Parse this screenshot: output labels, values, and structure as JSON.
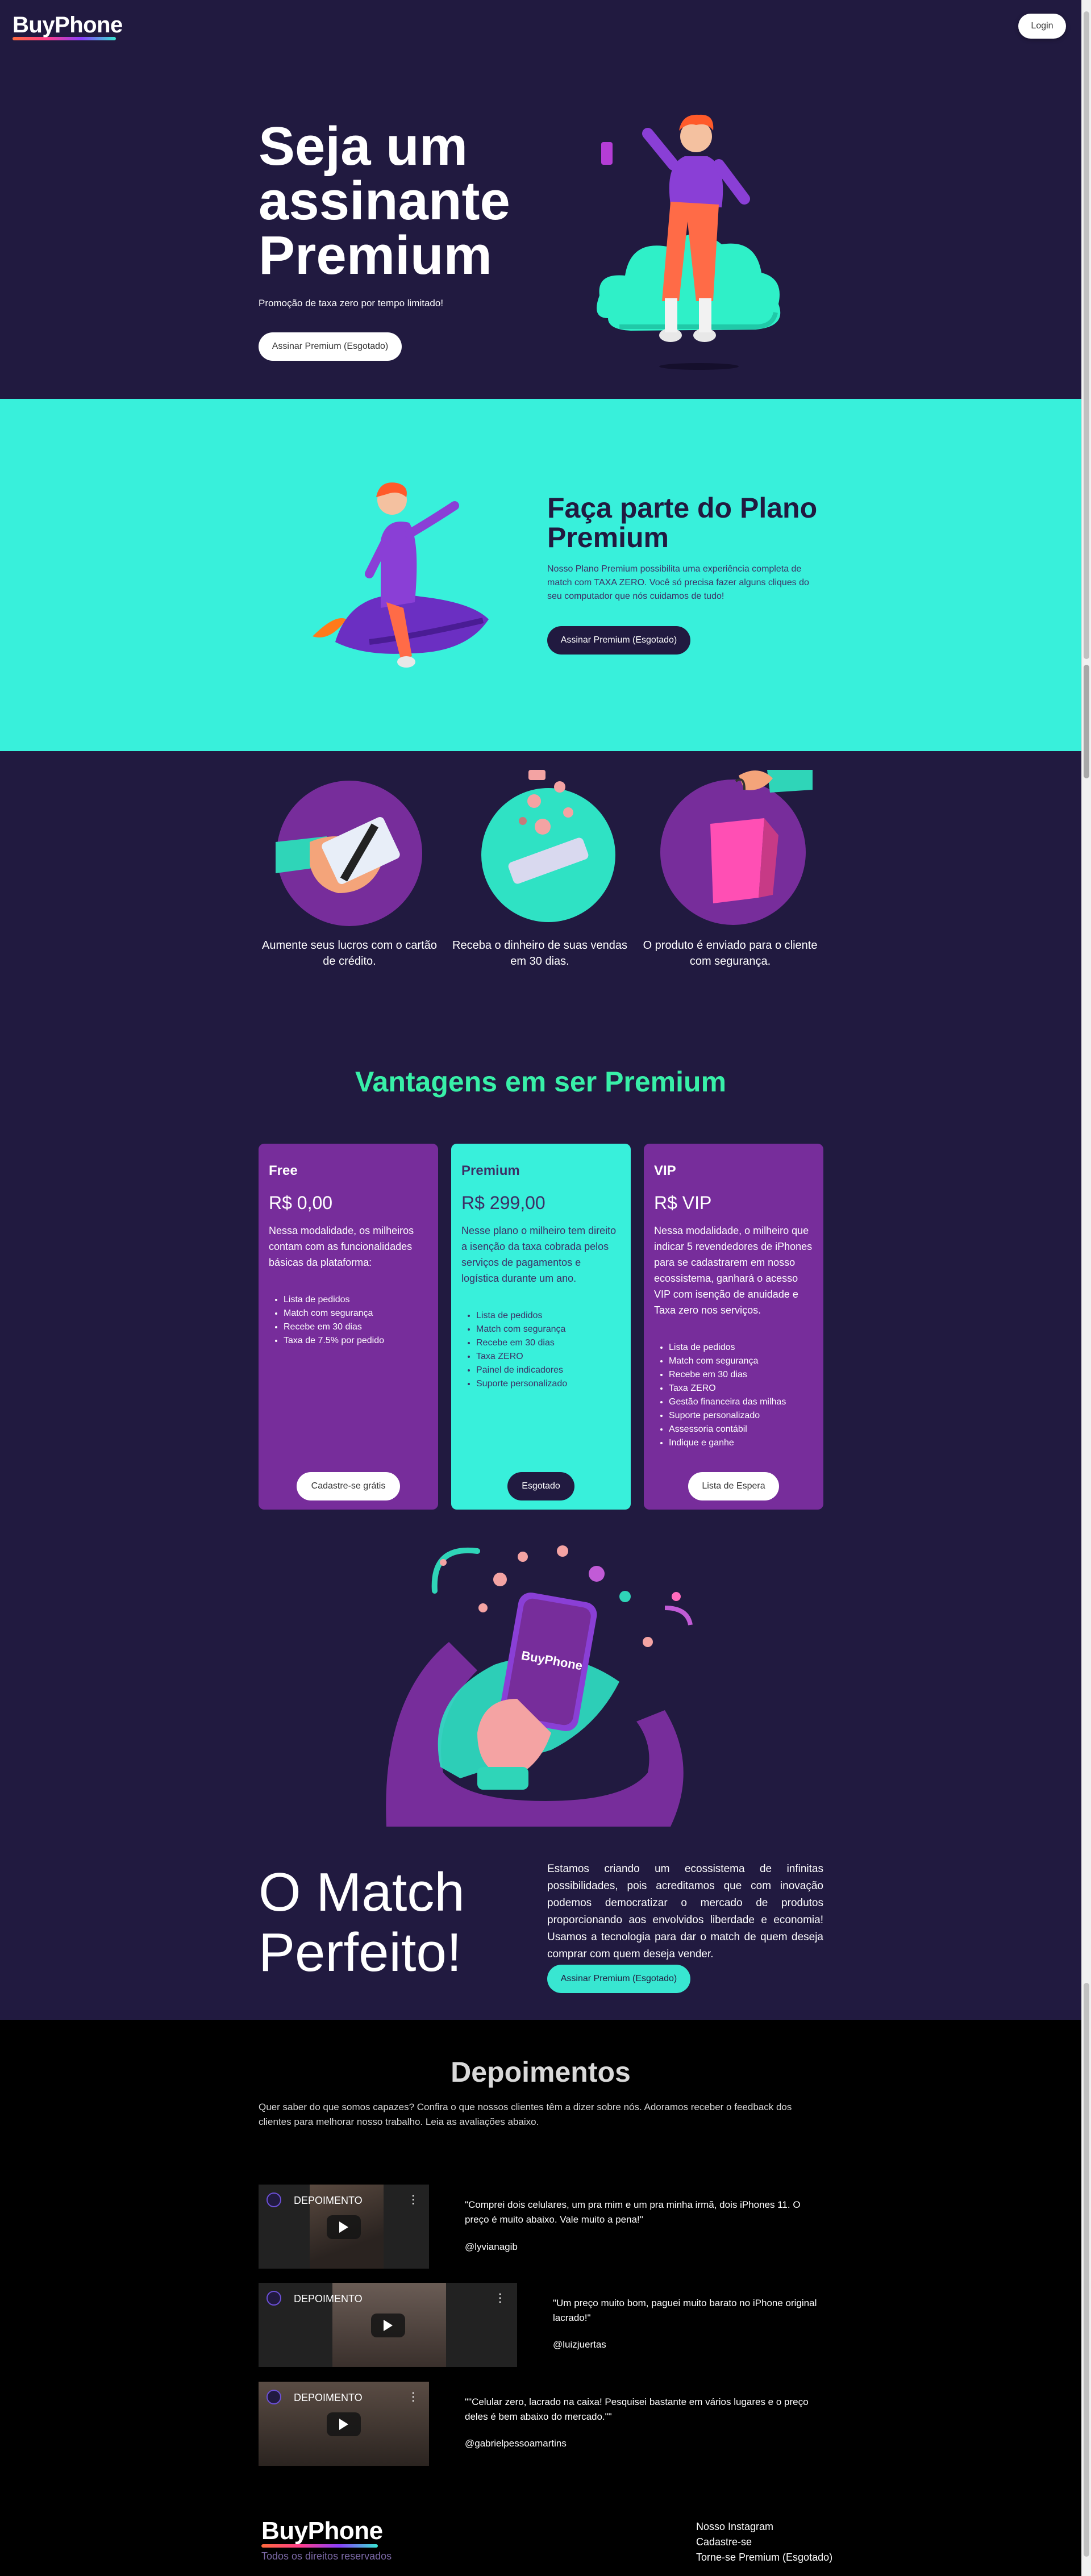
{
  "header": {
    "logo": "BuyPhone",
    "login": "Login"
  },
  "hero": {
    "title_lines": [
      "Seja um",
      "assinante",
      "Premium"
    ],
    "subtitle": "Promoção de taxa zero por tempo limitado!",
    "cta": "Assinar Premium (Esgotado)"
  },
  "plan": {
    "title_lines": [
      "Faça parte do Plano",
      "Premium"
    ],
    "text": "Nosso Plano Premium possibilita uma experiência completa de match com TAXA ZERO. Você só precisa fazer alguns cliques do seu computador que nós cuidamos de tudo!",
    "cta": "Assinar Premium (Esgotado)"
  },
  "features": [
    {
      "caption": "Aumente seus lucros com o cartão de crédito."
    },
    {
      "caption": "Receba o dinheiro de suas vendas em 30 dias."
    },
    {
      "caption": "O produto é enviado para o cliente com segurança."
    }
  ],
  "advantages": {
    "title": "Vantagens em ser Premium",
    "plans": [
      {
        "name": "Free",
        "price": "R$ 0,00",
        "desc": "Nessa modalidade, os milheiros contam com as funcionalidades básicas da plataforma:",
        "items": [
          "Lista de pedidos",
          "Match com segurança",
          "Recebe em 30 dias",
          "Taxa de 7.5% por pedido"
        ],
        "button": "Cadastre-se grátis"
      },
      {
        "name": "Premium",
        "price": "R$ 299,00",
        "desc": "Nesse plano o milheiro tem direito a isenção da taxa cobrada pelos serviços de pagamentos e logística durante um ano.",
        "items": [
          "Lista de pedidos",
          "Match com segurança",
          "Recebe em 30 dias",
          "Taxa ZERO",
          "Painel de indicadores",
          "Suporte personalizado"
        ],
        "button": "Esgotado"
      },
      {
        "name": "VIP",
        "price": "R$ VIP",
        "desc": "Nessa modalidade, o milheiro que indicar 5 revendedores de iPhones para se cadastrarem em nosso ecossistema, ganhará o acesso VIP com isenção de anuidade e Taxa zero nos serviços.",
        "items": [
          "Lista de pedidos",
          "Match com segurança",
          "Recebe em 30 dias",
          "Taxa ZERO",
          "Gestão financeira das milhas",
          "Suporte personalizado",
          "Assessoria contábil",
          "Indique e ganhe"
        ],
        "button": "Lista de Espera"
      }
    ]
  },
  "phone_logo": "BuyPhone",
  "match": {
    "title_lines": [
      "O Match",
      "Perfeito!"
    ],
    "text": "Estamos criando um ecossistema de infinitas possibilidades, pois acreditamos que com inovação podemos democratizar o mercado de produtos proporcionando aos envolvidos liberdade e economia! Usamos a tecnologia para dar o match de quem deseja comprar com quem deseja vender.",
    "cta": "Assinar Premium (Esgotado)"
  },
  "testimonials": {
    "title": "Depoimentos",
    "subtitle": "Quer saber do que somos capazes? Confira o que nossos clientes têm a dizer sobre nós. Adoramos receber o feedback dos clientes para melhorar nosso trabalho. Leia as avaliações abaixo.",
    "items": [
      {
        "video_label": "DEPOIMENTO",
        "quote": "\"Comprei dois celulares, um pra mim e um pra minha irmã, dois iPhones 11. O preço é muito abaixo. Vale muito a pena!\"",
        "handle": "@lyvianagib"
      },
      {
        "video_label": "DEPOIMENTO",
        "quote": "\"Um preço muito bom, paguei muito barato no iPhone original lacrado!\"",
        "handle": "@luizjuertas"
      },
      {
        "video_label": "DEPOIMENTO",
        "quote": "\"\"Celular zero, lacrado na caixa! Pesquisei bastante em vários lugares e o preço deles é bem abaixo do mercado.\"\"",
        "handle": "@gabrielpessoamartins"
      }
    ]
  },
  "footer": {
    "logo": "BuyPhone",
    "rights": "Todos os direitos reservados",
    "links": [
      "Nosso Instagram",
      "Cadastre-se",
      "Torne-se Premium (Esgotado)"
    ]
  },
  "colors": {
    "navy": "#211a40",
    "teal": "#38f0db",
    "purple": "#772d9b",
    "green": "#38f0a8"
  }
}
